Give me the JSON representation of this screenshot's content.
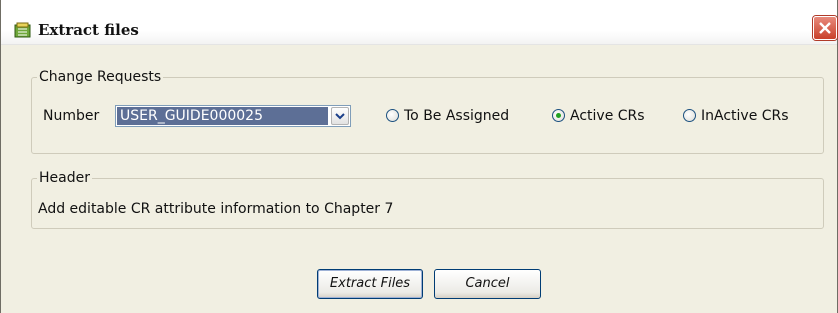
{
  "window": {
    "title": "Extract files",
    "icon": "extract-app-icon",
    "close_icon": "close-icon"
  },
  "change_requests": {
    "legend": "Change Requests",
    "number_label": "Number",
    "number_value": "USER_GUIDE000025",
    "radios": [
      {
        "label": "To Be Assigned",
        "selected": false
      },
      {
        "label": "Active CRs",
        "selected": true
      },
      {
        "label": "InActive CRs",
        "selected": false
      }
    ]
  },
  "header": {
    "legend": "Header",
    "text": "Add editable CR attribute information to Chapter 7"
  },
  "buttons": {
    "extract": "Extract Files",
    "cancel": "Cancel"
  },
  "colors": {
    "close_button": "#c9402a",
    "selected_radio_dot": "#21a121",
    "combo_highlight": "#5d6f96"
  }
}
